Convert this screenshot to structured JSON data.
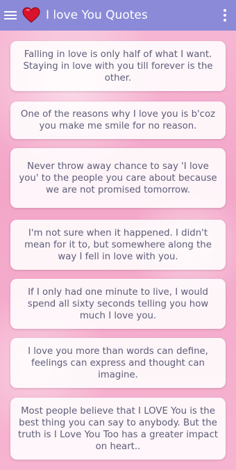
{
  "app_bar": {
    "title": "I love You Quotes",
    "menu_icon": "hamburger-menu-icon",
    "logo_icon": "heart-logo-icon",
    "more_icon": "more-vertical-icon",
    "background_color": "#8a8ad8"
  },
  "quotes": [
    "Falling in love is only half of what I want. Staying in love with you till forever is the other.",
    "One of the reasons why I love you is b'coz you make me smile for no reason.",
    "Never throw away chance to say 'I love you' to the people you care about because we are not promised tomorrow.",
    "I'm not sure when it happened. I didn't mean for it to, but somewhere along the way I fell in love with you.",
    "If I only had one minute to live, I would spend all sixty seconds telling you how much I love you.",
    "I love you more than words can define, feelings can express and thought can imagine.",
    "Most people believe that I LOVE You is the best thing you can say to anybody. But the truth is I Love You Too has a greater impact on heart.."
  ]
}
